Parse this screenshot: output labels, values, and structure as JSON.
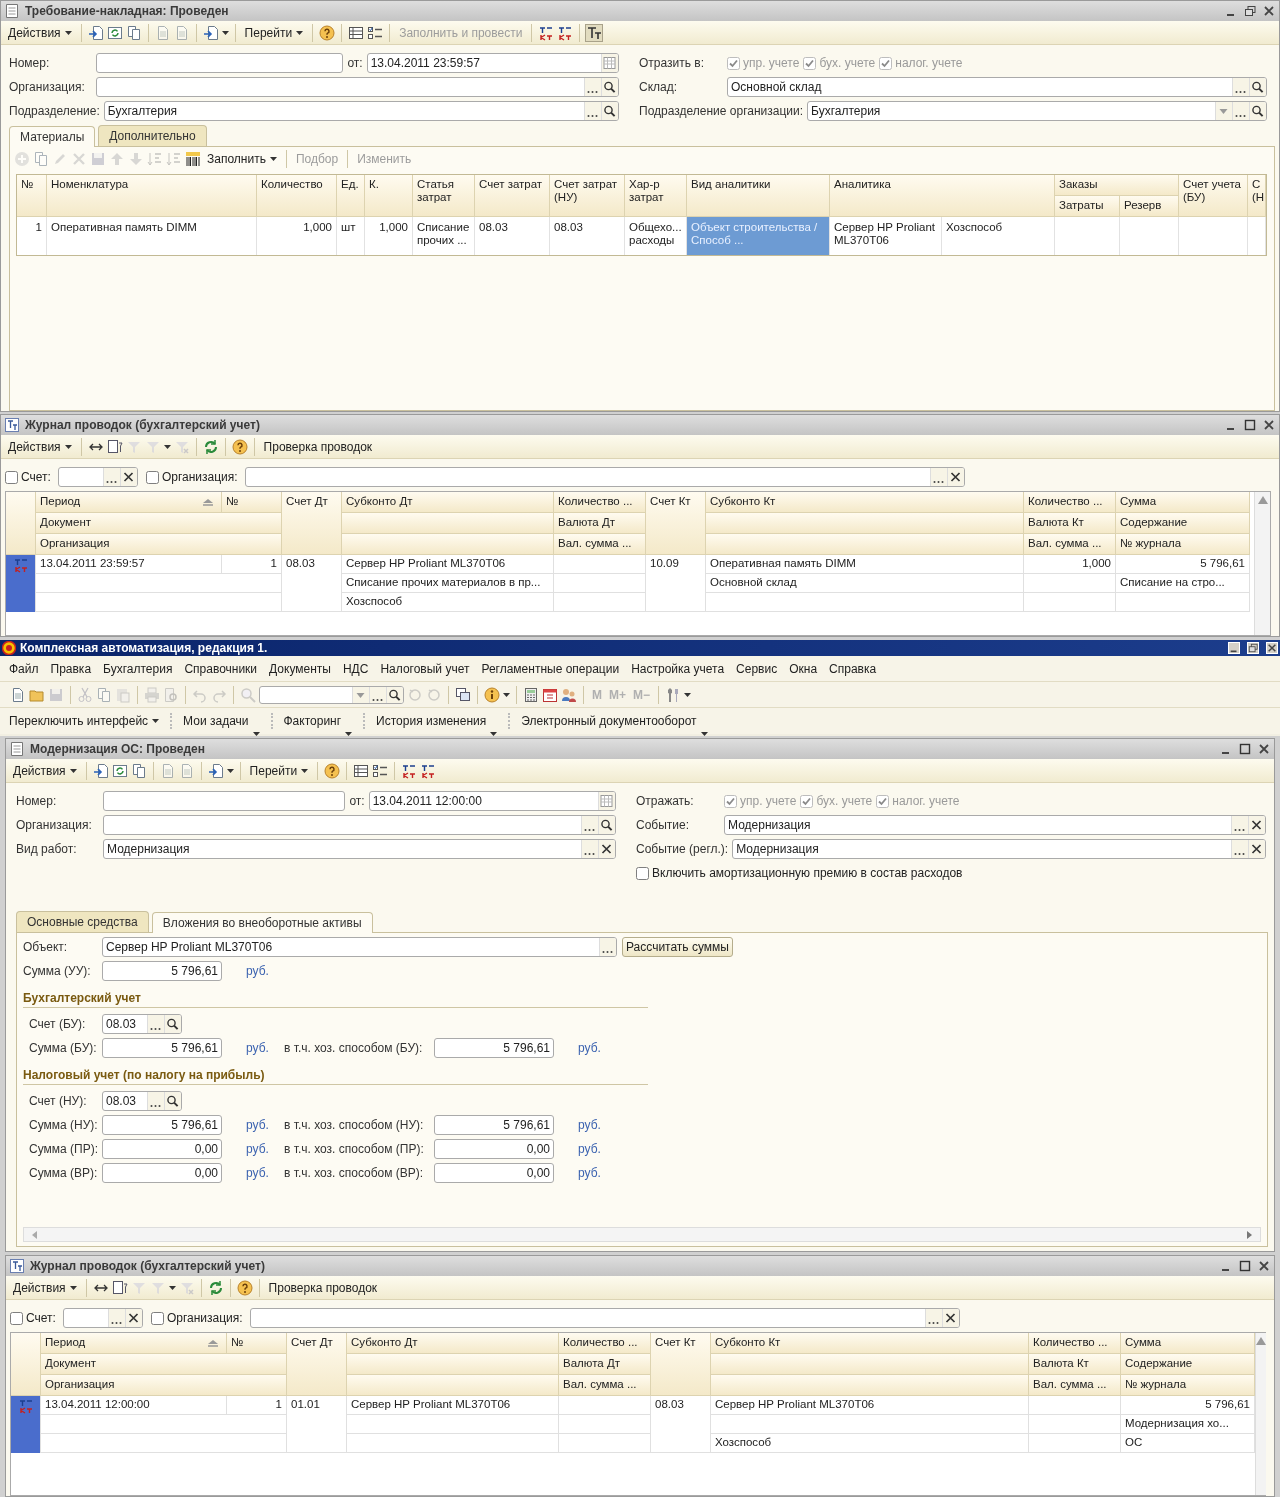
{
  "form1": {
    "title": "Требование-накладная: Проведен",
    "toolbar": [
      {
        "label": "Действия",
        "kind": "menu",
        "disabled": false
      },
      {
        "label": "Перейти",
        "kind": "menu",
        "disabled": false
      },
      {
        "label": "Заполнить и провести",
        "kind": "button",
        "disabled": true
      }
    ],
    "header": {
      "left": [
        [
          {
            "label": "Номер:",
            "kind": "text"
          },
          {
            "label": "от:",
            "value": "13.04.2011 23:59:57",
            "kind": "date"
          }
        ],
        [
          {
            "label": "Организация:",
            "kind": "select"
          }
        ],
        [
          {
            "label": "Подразделение:",
            "value": "Бухгалтерия",
            "kind": "select"
          }
        ]
      ],
      "right": [
        [
          {
            "label": "Отразить в:",
            "kind": "checks",
            "options": [
              {
                "label": "упр. учете",
                "checked": true,
                "disabled": true
              },
              {
                "label": "бух. учете",
                "checked": true,
                "disabled": true
              },
              {
                "label": "налог. учете",
                "checked": true,
                "disabled": true
              }
            ]
          }
        ],
        [
          {
            "label": "Склад:",
            "value": "Основной склад",
            "kind": "select"
          }
        ],
        [
          {
            "label": "Подразделение организации:",
            "value": "Бухгалтерия",
            "kind": "dropdown"
          }
        ]
      ]
    },
    "tabs": [
      {
        "label": "Материалы",
        "selected": true
      },
      {
        "label": "Дополнительно",
        "selected": false
      }
    ],
    "table_toolbar": [
      {
        "label": "Заполнить",
        "kind": "menu",
        "disabled": false
      },
      {
        "label": "Подбор",
        "kind": "button",
        "disabled": true
      },
      {
        "label": "Изменить",
        "kind": "button",
        "disabled": true
      }
    ],
    "table": {
      "columns": [
        {
          "label": "№"
        },
        {
          "label": "Номенклатура"
        },
        {
          "label": "Количество"
        },
        {
          "label": "Ед."
        },
        {
          "label": "К."
        },
        {
          "label": "Статья затрат"
        },
        {
          "label": "Счет затрат"
        },
        {
          "label": "Счет затрат (НУ)"
        },
        {
          "label": "Хар-р затрат"
        },
        {
          "label": "Вид аналитики"
        },
        {
          "label": "Аналитика"
        },
        {
          "label": "Заказы",
          "children": [
            {
              "label": "Затраты"
            },
            {
              "label": "Резерв"
            }
          ]
        },
        {
          "label": "Счет учета (БУ)"
        },
        {
          "label": "С (Н"
        }
      ],
      "rows": [
        {
          "cells": [
            {
              "text": "1",
              "selected": false
            },
            {
              "text": "Оперативная память DIMM",
              "selected": false
            },
            {
              "text": "1,000",
              "selected": false
            },
            {
              "text": "шт",
              "selected": false
            },
            {
              "text": "1,000",
              "selected": false
            },
            {
              "text": "Списание прочих ...",
              "selected": false
            },
            {
              "text": "08.03",
              "selected": false
            },
            {
              "text": "08.03",
              "selected": false
            },
            {
              "text": "Общехо... расходы",
              "selected": false
            },
            {
              "text": "Объект строительства / Способ ...",
              "selected": true
            },
            {
              "text": "Сервер HP Proliant ML370T06",
              "selected": false
            },
            {
              "text": "Хозспособ",
              "selected": false
            },
            {
              "selected": false
            },
            {
              "selected": false
            },
            {
              "selected": false
            },
            {
              "selected": false
            }
          ]
        }
      ]
    }
  },
  "journal1": {
    "title": "Журнал проводок (бухгалтерский учет)",
    "toolbar": [
      {
        "label": "Действия",
        "kind": "menu",
        "disabled": false
      },
      {
        "label": "Проверка проводок",
        "kind": "button",
        "disabled": false
      }
    ],
    "filters": [
      {
        "label": "Счет:",
        "checked": false,
        "kind": "short"
      },
      {
        "label": "Организация:",
        "checked": false,
        "kind": "long"
      }
    ],
    "header": {
      "period": "Период",
      "number": "№",
      "document": "Документ",
      "organization": "Организация",
      "dt_account": "Счет Дт",
      "dt_sub1": "Субконто Дт",
      "dt_qty": "Количество ...",
      "dt_currency": "Валюта Дт",
      "dt_cur_sum": "Вал. сумма ...",
      "kt_account": "Счет Кт",
      "kt_sub1": "Субконто Кт",
      "kt_qty": "Количество ...",
      "kt_currency": "Валюта Кт",
      "kt_cur_sum": "Вал. сумма ...",
      "sum": "Сумма",
      "content": "Содержание",
      "journal_no": "№ журнала"
    },
    "records": [
      {
        "selected": true,
        "period": "13.04.2011 23:59:57",
        "number": "1",
        "dt_account": "08.03",
        "dt_sub1": "Сервер HP Proliant ML370T06",
        "dt_sub2": "Списание прочих материалов в пр...",
        "dt_sub3": "Хозспособ",
        "kt_account": "10.09",
        "kt_sub1": "Оперативная память DIMM",
        "kt_sub2": "Основной склад",
        "kt_qty": "1,000",
        "sum": "5 796,61",
        "content": "Списание на стро..."
      }
    ]
  },
  "app": {
    "title": "Комплексная автоматизация, редакция 1.",
    "menu": [
      "Файл",
      "Правка",
      "Бухгалтерия",
      "Справочники",
      "Документы",
      "НДС",
      "Налоговый учет",
      "Регламентные операции",
      "Настройка учета",
      "Сервис",
      "Окна",
      "Справка"
    ],
    "memory_buttons": [
      {
        "label": "M",
        "disabled": true
      },
      {
        "label": "M+",
        "disabled": true
      },
      {
        "label": "M−",
        "disabled": true
      }
    ],
    "panel": [
      {
        "label": "Переключить интерфейс",
        "kind": "menu"
      },
      {
        "label": "Мои задачи",
        "kind": "panel"
      },
      {
        "label": "Факторинг",
        "kind": "panel"
      },
      {
        "label": "История изменения",
        "kind": "panel"
      },
      {
        "label": "Электронный документооборот",
        "kind": "panel"
      }
    ]
  },
  "form2": {
    "title": "Модернизация ОС: Проведен",
    "toolbar": [
      {
        "label": "Действия",
        "kind": "menu",
        "disabled": false
      },
      {
        "label": "Перейти",
        "kind": "menu",
        "disabled": false
      }
    ],
    "header": {
      "left": [
        [
          {
            "label": "Номер:",
            "kind": "text"
          },
          {
            "label": "от:",
            "value": "13.04.2011 12:00:00",
            "kind": "date"
          }
        ],
        [
          {
            "label": "Организация:",
            "kind": "select"
          }
        ],
        [
          {
            "label": "Вид работ:",
            "value": "Модернизация",
            "kind": "clear"
          }
        ]
      ],
      "right": [
        [
          {
            "label": "Отражать:",
            "kind": "checks",
            "options": [
              {
                "label": "упр. учете",
                "checked": true,
                "disabled": true
              },
              {
                "label": "бух. учете",
                "checked": true,
                "disabled": true
              },
              {
                "label": "налог. учете",
                "checked": true,
                "disabled": true
              }
            ]
          }
        ],
        [
          {
            "label": "Событие:",
            "value": "Модернизация",
            "kind": "clear"
          }
        ],
        [
          {
            "label": "Событие (регл.):",
            "value": "Модернизация",
            "kind": "clear"
          }
        ],
        [
          {
            "label": "Включить амортизационную премию в состав расходов",
            "kind": "checkbox",
            "checked": false
          }
        ]
      ]
    },
    "tabs": [
      {
        "label": "Основные средства",
        "selected": false
      },
      {
        "label": "Вложения во внеоборотные активы",
        "selected": true
      }
    ],
    "content": [
      {
        "kind": "object",
        "label": "Объект:",
        "value": "Сервер HP Proliant ML370T06",
        "button": "Рассчитать суммы"
      },
      {
        "kind": "amount",
        "label": "Сумма (УУ):",
        "value": "5 796,61",
        "unit": "руб."
      },
      {
        "kind": "section",
        "label": "Бухгалтерский учет"
      },
      {
        "kind": "account",
        "label": "Счет (БУ):",
        "value": "08.03"
      },
      {
        "kind": "amount",
        "label": "Сумма (БУ):",
        "value": "5 796,61",
        "unit": "руб.",
        "label2": "в т.ч. хоз. способом (БУ):",
        "value2": "5 796,61",
        "unit2": "руб."
      },
      {
        "kind": "section",
        "label": "Налоговый учет (по налогу на прибыль)"
      },
      {
        "kind": "account",
        "label": "Счет (НУ):",
        "value": "08.03"
      },
      {
        "kind": "amount",
        "label": "Сумма (НУ):",
        "value": "5 796,61",
        "unit": "руб.",
        "label2": "в т.ч. хоз. способом (НУ):",
        "value2": "5 796,61",
        "unit2": "руб."
      },
      {
        "kind": "amount",
        "label": "Сумма (ПР):",
        "value": "0,00",
        "unit": "руб.",
        "label2": "в т.ч. хоз. способом (ПР):",
        "value2": "0,00",
        "unit2": "руб."
      },
      {
        "kind": "amount",
        "label": "Сумма (ВР):",
        "value": "0,00",
        "unit": "руб.",
        "label2": "в т.ч. хоз. способом (ВР):",
        "value2": "0,00",
        "unit2": "руб."
      }
    ]
  },
  "journal2": {
    "title": "Журнал проводок (бухгалтерский учет)",
    "toolbar": [
      {
        "label": "Действия",
        "kind": "menu",
        "disabled": false
      },
      {
        "label": "Проверка проводок",
        "kind": "button",
        "disabled": false
      }
    ],
    "filters": [
      {
        "label": "Счет:",
        "checked": false,
        "kind": "short"
      },
      {
        "label": "Организация:",
        "checked": false,
        "kind": "long"
      }
    ],
    "header": {
      "period": "Период",
      "number": "№",
      "document": "Документ",
      "organization": "Организация",
      "dt_account": "Счет Дт",
      "dt_sub1": "Субконто Дт",
      "dt_qty": "Количество ...",
      "dt_currency": "Валюта Дт",
      "dt_cur_sum": "Вал. сумма ...",
      "kt_account": "Счет Кт",
      "kt_sub1": "Субконто Кт",
      "kt_qty": "Количество ...",
      "kt_currency": "Валюта Кт",
      "kt_cur_sum": "Вал. сумма ...",
      "sum": "Сумма",
      "content": "Содержание",
      "journal_no": "№ журнала"
    },
    "records": [
      {
        "selected": true,
        "period": "13.04.2011 12:00:00",
        "number": "1",
        "dt_account": "01.01",
        "dt_sub1": "Сервер HP Proliant ML370T06",
        "kt_account": "08.03",
        "kt_sub1": "Сервер HP Proliant ML370T06",
        "kt_sub3": "Хозспособ",
        "sum": "5 796,61",
        "content": "Модернизация хо...",
        "journal_no": "ОС"
      }
    ]
  }
}
